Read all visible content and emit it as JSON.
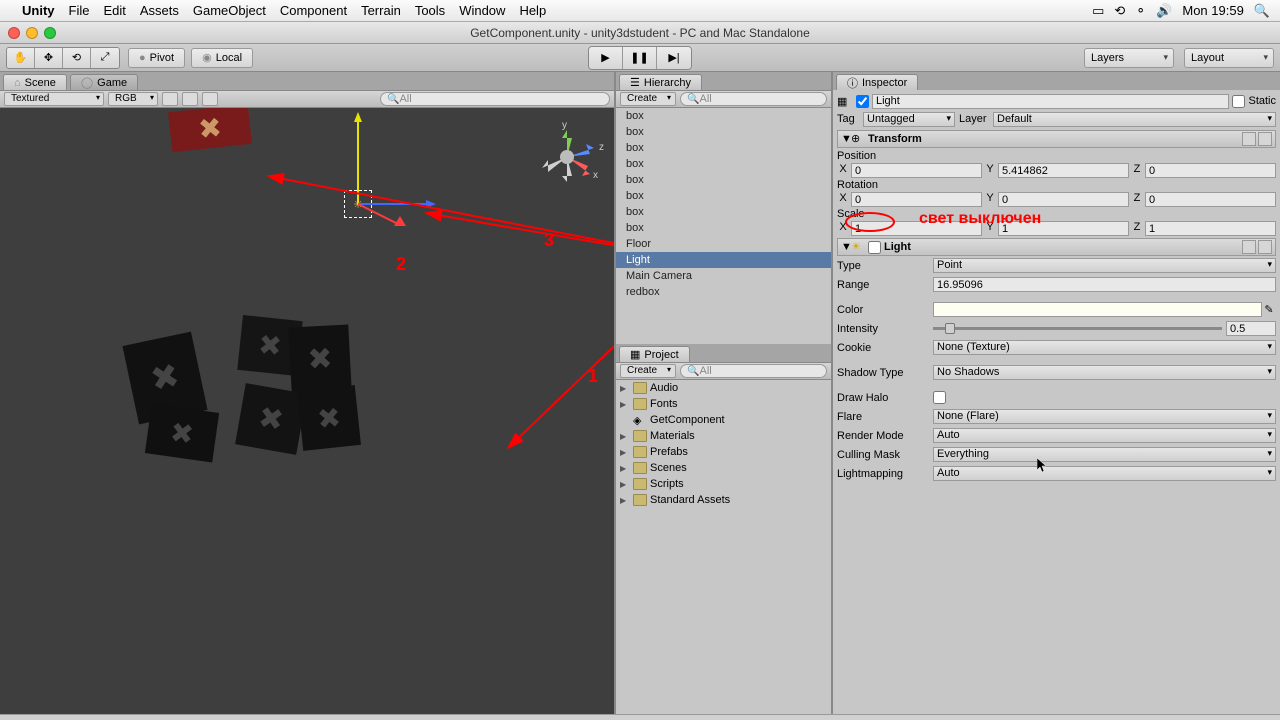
{
  "menubar": {
    "app": "Unity",
    "items": [
      "File",
      "Edit",
      "Assets",
      "GameObject",
      "Component",
      "Terrain",
      "Tools",
      "Window",
      "Help"
    ],
    "clock": "Mon 19:59"
  },
  "window": {
    "title": "GetComponent.unity - unity3dstudent - PC and Mac Standalone"
  },
  "toolbar": {
    "pivot": "Pivot",
    "local": "Local",
    "layers": "Layers",
    "layout": "Layout"
  },
  "scene": {
    "tab_scene": "Scene",
    "tab_game": "Game",
    "shade": "Textured",
    "rgb": "RGB",
    "search_ph": "All"
  },
  "hierarchy": {
    "title": "Hierarchy",
    "create": "Create",
    "search_ph": "All",
    "items": [
      "box",
      "box",
      "box",
      "box",
      "box",
      "box",
      "box",
      "box",
      "Floor",
      "Light",
      "Main Camera",
      "redbox"
    ],
    "selected": "Light"
  },
  "project": {
    "title": "Project",
    "create": "Create",
    "search_ph": "All",
    "items": [
      {
        "name": "Audio",
        "folder": true,
        "fold": true
      },
      {
        "name": "Fonts",
        "folder": true,
        "fold": true
      },
      {
        "name": "GetComponent",
        "folder": false,
        "fold": false
      },
      {
        "name": "Materials",
        "folder": true,
        "fold": true
      },
      {
        "name": "Prefabs",
        "folder": true,
        "fold": true
      },
      {
        "name": "Scenes",
        "folder": true,
        "fold": true
      },
      {
        "name": "Scripts",
        "folder": true,
        "fold": true
      },
      {
        "name": "Standard Assets",
        "folder": true,
        "fold": true
      }
    ]
  },
  "inspector": {
    "title": "Inspector",
    "obj_name": "Light",
    "static": "Static",
    "tag_label": "Tag",
    "tag": "Untagged",
    "layer_label": "Layer",
    "layer": "Default",
    "transform": {
      "title": "Transform",
      "position_label": "Position",
      "position": {
        "x": "0",
        "y": "5.414862",
        "z": "0"
      },
      "rotation_label": "Rotation",
      "rotation": {
        "x": "0",
        "y": "0",
        "z": "0"
      },
      "scale_label": "Scale",
      "scale": {
        "x": "1",
        "y": "1",
        "z": "1"
      }
    },
    "light": {
      "title": "Light",
      "type_label": "Type",
      "type": "Point",
      "range_label": "Range",
      "range": "16.95096",
      "color_label": "Color",
      "intensity_label": "Intensity",
      "intensity": "0.5",
      "cookie_label": "Cookie",
      "cookie": "None (Texture)",
      "shadow_label": "Shadow Type",
      "shadow": "No Shadows",
      "halo_label": "Draw Halo",
      "flare_label": "Flare",
      "flare": "None (Flare)",
      "render_label": "Render Mode",
      "render": "Auto",
      "cull_label": "Culling Mask",
      "cull": "Everything",
      "lightmap_label": "Lightmapping",
      "lightmap": "Auto"
    }
  },
  "annotations": {
    "text": "свет выключен",
    "n1": "1",
    "n2": "2",
    "n3": "3"
  },
  "axes": {
    "x": "x",
    "y": "y",
    "z": "z"
  }
}
